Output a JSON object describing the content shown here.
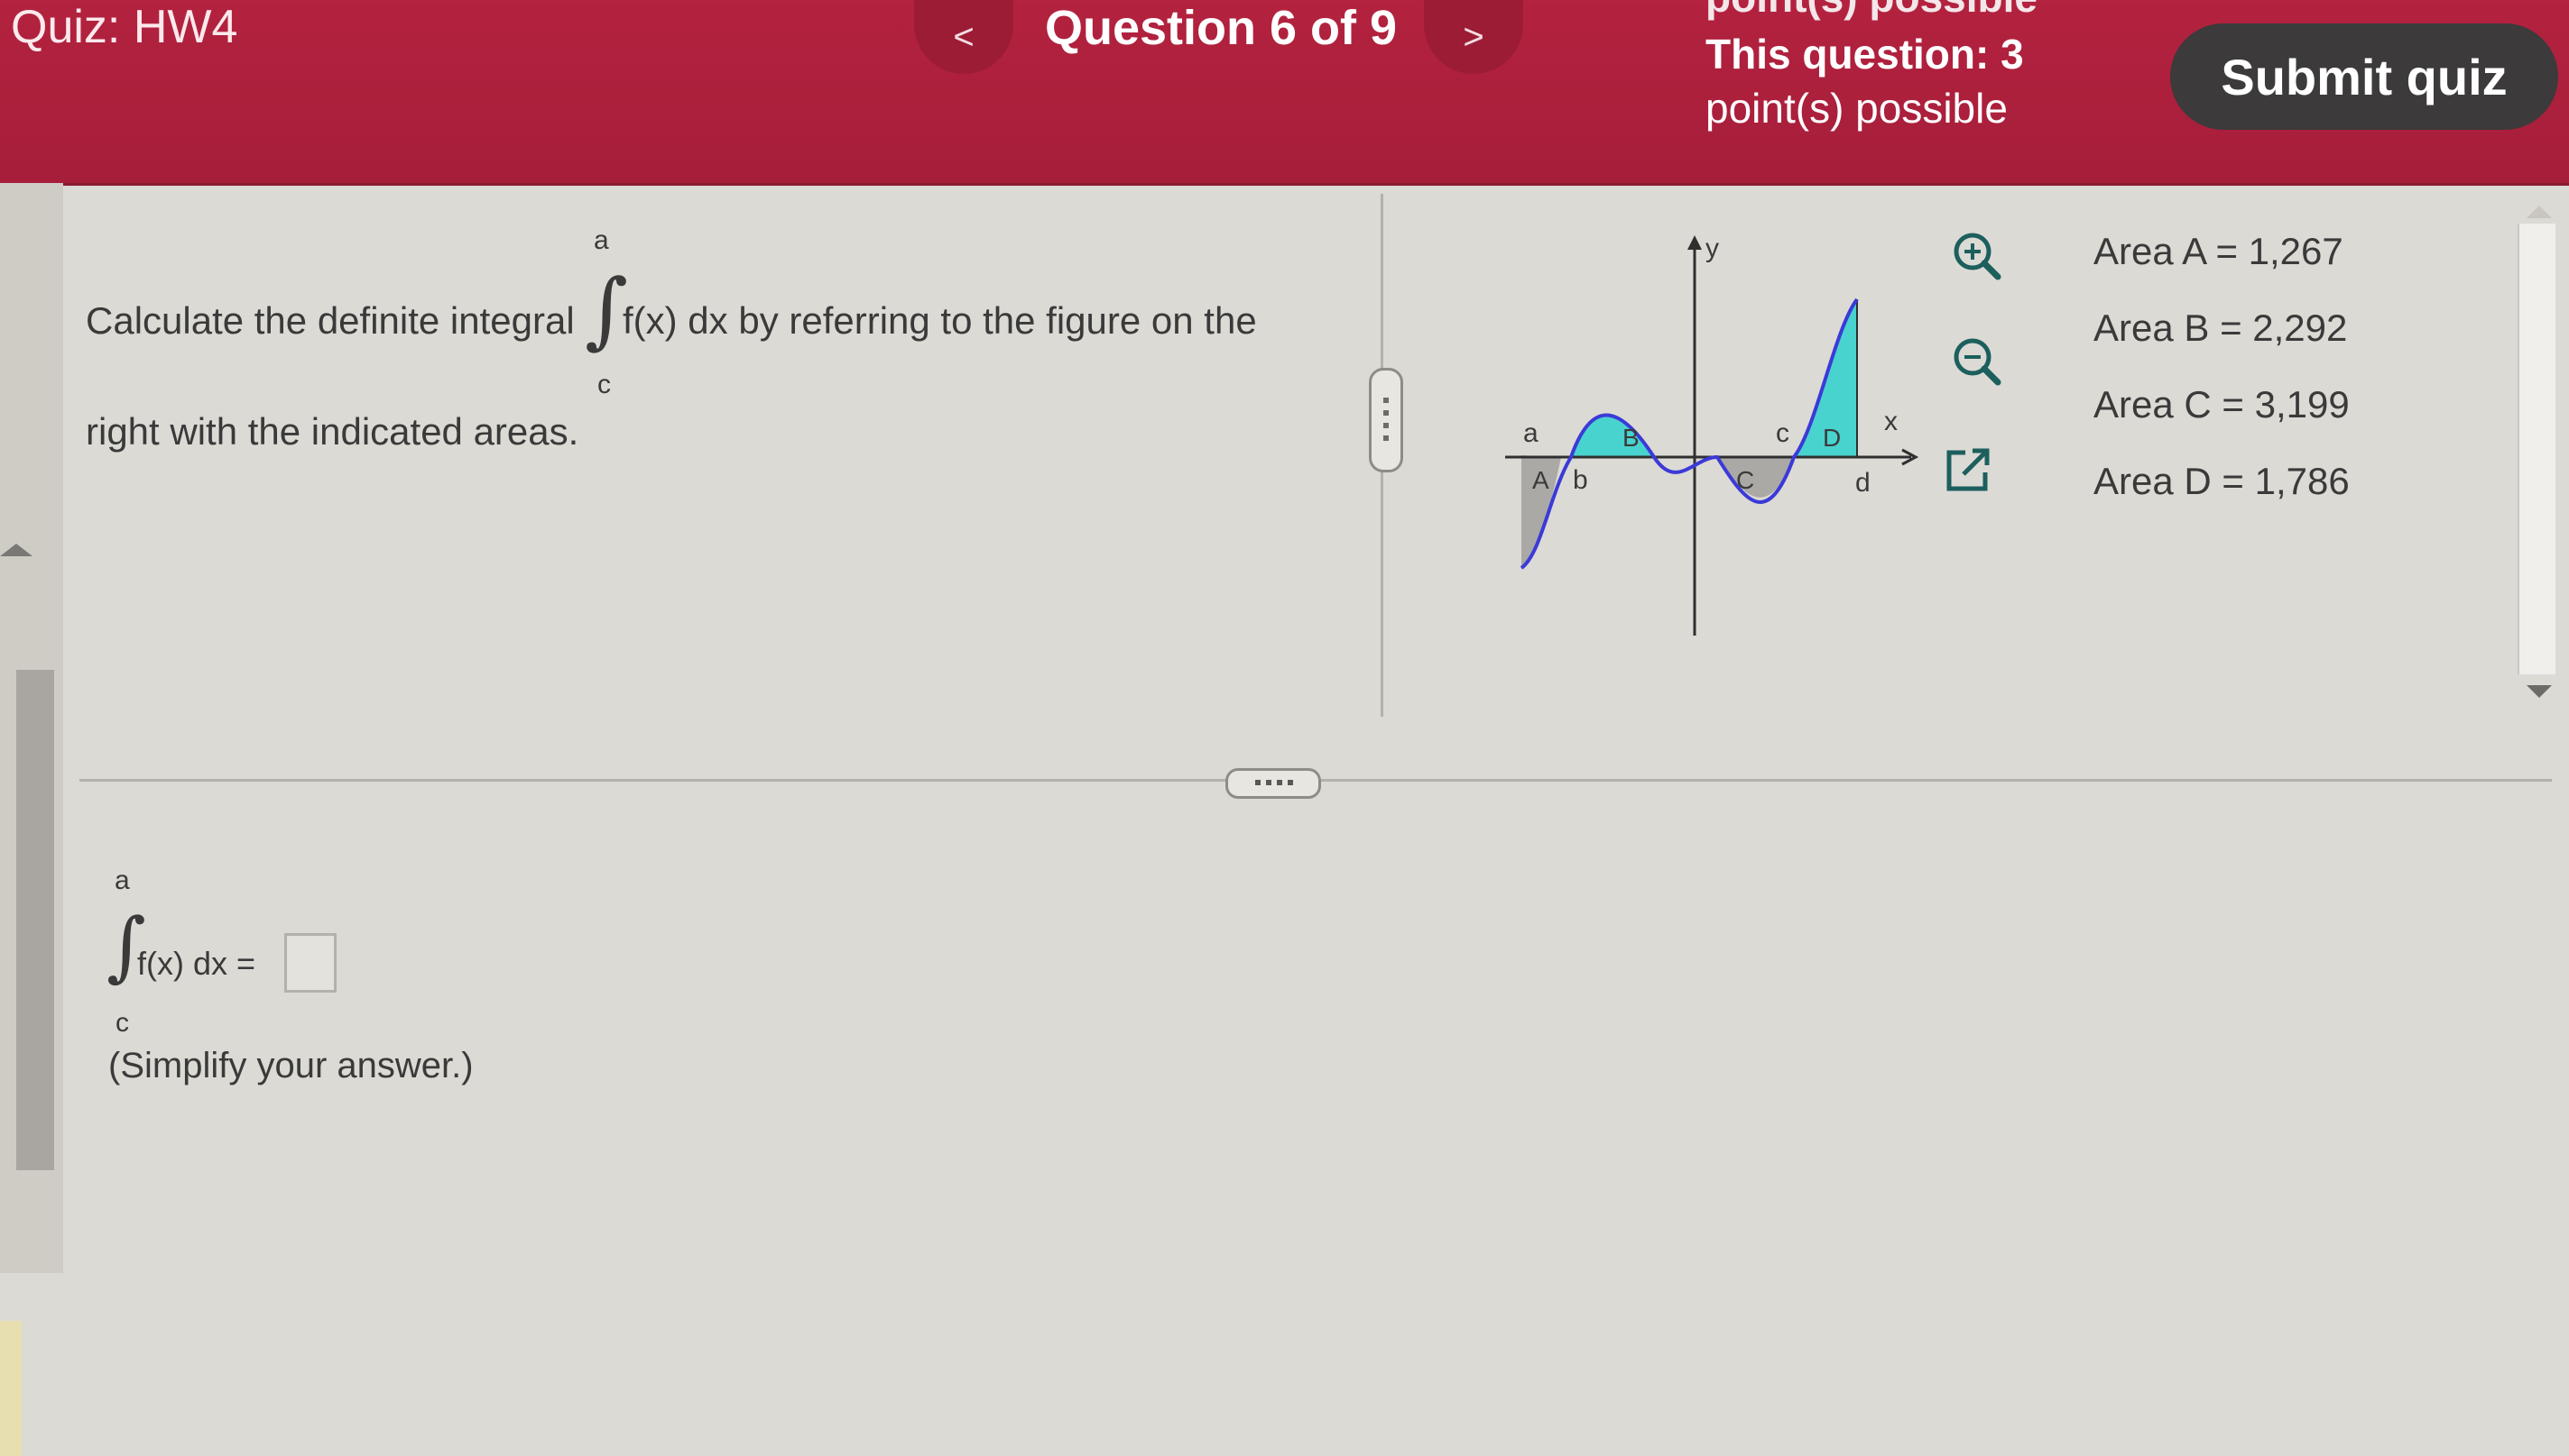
{
  "header": {
    "quiz_title": "Quiz: HW4",
    "prev_label": "<",
    "next_label": ">",
    "question_counter": "Question 6 of 9",
    "points_cut_text": "point(s) possible",
    "points_line1": "This question: 3",
    "points_line2": "point(s) possible",
    "submit_label": "Submit quiz"
  },
  "question": {
    "text_before": "Calculate the definite integral",
    "text_after": "f(x) dx by referring to the figure on the",
    "text_line2": "right with the indicated areas.",
    "upper_limit": "a",
    "lower_limit": "c",
    "integral_symbol": "∫"
  },
  "figure": {
    "axis_x": "x",
    "axis_y": "y",
    "point_a": "a",
    "point_b": "b",
    "point_c": "c",
    "point_d": "d",
    "region_A": "A",
    "region_B": "B",
    "region_C": "C",
    "region_D": "D",
    "colors": {
      "curve": "#3b3ad8",
      "above_fill": "#48d3cf",
      "below_fill": "#9a9894"
    },
    "icons": [
      "zoom-in-icon",
      "zoom-out-icon",
      "popout-icon"
    ]
  },
  "areas": [
    {
      "label": "Area A",
      "value": "= 1,267"
    },
    {
      "label": "Area B",
      "value": "= 2,292"
    },
    {
      "label": "Area C",
      "value": "= 3,199"
    },
    {
      "label": "Area D",
      "value": "= 1,786"
    }
  ],
  "answer": {
    "upper_limit": "a",
    "lower_limit": "c",
    "integral_symbol": "∫",
    "expression": "f(x) dx =",
    "input_value": "",
    "simplify_text": "(Simplify your answer.)"
  }
}
